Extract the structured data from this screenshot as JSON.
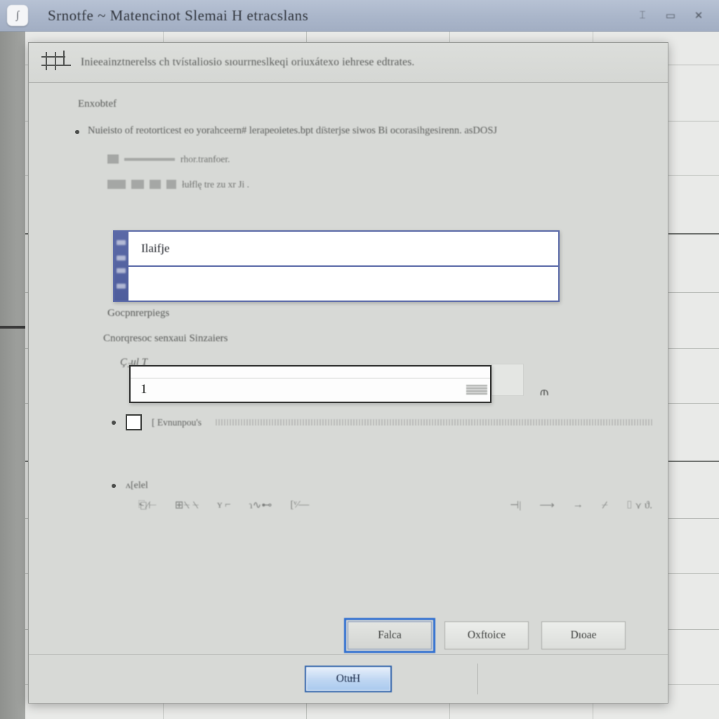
{
  "window": {
    "app_icon": "script-app-icon",
    "title": "Srnotfe  ~ Matencinot Slemai H etracslans",
    "controls": [
      {
        "name": "minimize-button",
        "glyph": "⌶"
      },
      {
        "name": "maximize-button",
        "glyph": "▭"
      },
      {
        "name": "close-button",
        "glyph": "✕"
      }
    ]
  },
  "dialog": {
    "header": {
      "icon": "table-grid-icon",
      "title": "Inieeainztnerelss ch tvístaliosio sıourrneslkeqi oriuxátexo iehrese edtrates."
    },
    "intro_label": "Enxobtef",
    "intro_bullet": "Nuieisto of reotorticest eo yorahceern# lerapeoietes.bpt dı̈sterjse siwos Bi ocorasihgesirenn. asDOSJ",
    "field_label_1": "rhor.tranfoer.",
    "field_label_2": "łułflę tre  zu  xr Ji .",
    "listbox": {
      "name": "name-listbox",
      "rows": [
        {
          "text": "Ilaifje"
        },
        {
          "text": ""
        }
      ],
      "gutter_marks": 4
    },
    "section_label_1": "Gocpnrerpiegs",
    "section_label_2": "Cnorqresoc senxaui Sinzaiers",
    "input_caption": "Ç₂ul T",
    "text_input": {
      "name": "quantity-input",
      "value": "1",
      "placeholder": ""
    },
    "spinner_glyph": "⫙",
    "checkbox_row": {
      "label": "[ Evnunpou's",
      "checked": false
    },
    "last_bullet": {
      "label": "ʌ[elel",
      "glyphs": [
        "⎗∕⊢",
        "⊞⍀ ⍀",
        "ʏ  ⌐",
        "ɿ∿⊷",
        "[ᵛ⁄—",
        "⊣|",
        "⟶",
        "→",
        "⌿",
        "⌷ ⋎ ϑ."
      ]
    },
    "buttons": [
      {
        "name": "apply-button",
        "label": "Falca",
        "focused": true
      },
      {
        "name": "options-button",
        "label": "Oxftoice",
        "focused": false
      },
      {
        "name": "close-button",
        "label": "Dıoae",
        "focused": false
      }
    ],
    "primary_button": {
      "name": "ok-button",
      "label": "Otu̶H"
    }
  },
  "background": {
    "type": "spreadsheet-grid",
    "row_lines": [
      48,
      128,
      205,
      288,
      372,
      452,
      530,
      612,
      694,
      772,
      852,
      930
    ],
    "strong_rows": [
      288,
      612
    ],
    "col_lines": [
      196,
      400,
      604,
      808
    ],
    "left_panel_color": "#9a9c99"
  },
  "colors": {
    "titlebar": "#aab6ca",
    "dialog_bg": "#d7d9d6",
    "accent_blue": "#2b5fa8",
    "listbox_border": "#5b6aa8",
    "focus_ring": "#2f6fd0"
  }
}
